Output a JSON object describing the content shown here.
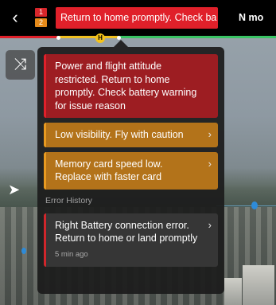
{
  "header": {
    "back_icon": "chevron-left-icon",
    "badge_red_count": "1",
    "badge_orange_count": "2",
    "alert_text": "Return to home promptly. Check ba",
    "mode_text": "N mo"
  },
  "colors": {
    "critical": "#e0202a",
    "warning": "#e89a20",
    "battery_ok": "#39c463",
    "home_marker": "#f3c21a"
  },
  "map": {
    "home_marker_label": "H",
    "route_icon": "route-icon",
    "takeoff_icon": "aircraft-icon"
  },
  "panel": {
    "alerts": [
      {
        "level": "critical",
        "text": "Power and flight attitude restricted. Return to home promptly. Check battery warning for issue reason"
      },
      {
        "level": "warning",
        "text": "Low visibility. Fly with caution"
      },
      {
        "level": "warning",
        "text": "Memory card speed low. Replace with faster card"
      }
    ],
    "history_title": "Error History",
    "history": [
      {
        "text": "Right Battery connection error. Return to home or land promptly",
        "time": "5 min ago"
      }
    ]
  }
}
